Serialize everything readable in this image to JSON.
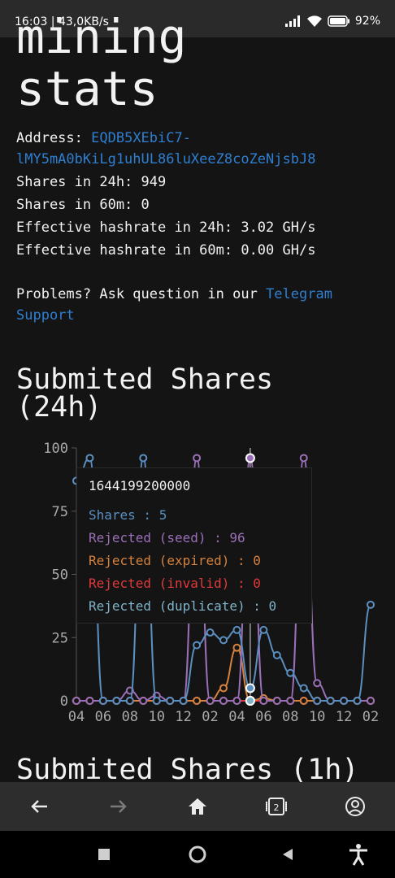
{
  "status": {
    "time": "16:03 | 43,0KB/s",
    "battery": "92"
  },
  "page": {
    "title_line1": "mining",
    "title_line2": "stats",
    "address_label": "Address:",
    "address_part1": "EQDB5XEbiC7-",
    "address_part2": "lMY5mA0bKiLg1uhUL86luXeeZ8coZeNjsbJ8",
    "shares_24h": "Shares in 24h: 949",
    "shares_60m": "Shares in 60m: 0",
    "hashrate_24h": "Effective hashrate in 24h: 3.02 GH/s",
    "hashrate_60m": "Effective hashrate in 60m: 0.00 GH/s",
    "problems_text": "Problems? Ask question in our",
    "telegram_link1": "Telegram",
    "telegram_link2": "Support",
    "section_24h_line1": "Submited Shares",
    "section_24h_line2": "(24h)",
    "section_1h": "Submited Shares (1h)"
  },
  "tooltip": {
    "title": "1644199200000",
    "shares": "Shares : 5",
    "seed": "Rejected (seed) : 96",
    "expired": "Rejected (expired) : 0",
    "invalid": "Rejected (invalid) : 0",
    "duplicate": "Rejected (duplicate) : 0"
  },
  "colors": {
    "shares": "#5b8fc0",
    "seed": "#9b6fb8",
    "expired": "#d6813c",
    "invalid": "#e03a3a",
    "duplicate": "#7fb3c8",
    "link": "#2f7fd1"
  },
  "chart_data": {
    "type": "line",
    "title": "Submited Shares (24h)",
    "categories": [
      "04",
      "05",
      "06",
      "07",
      "08",
      "09",
      "10",
      "11",
      "12",
      "01",
      "02",
      "03",
      "04",
      "05",
      "06",
      "07",
      "08",
      "09",
      "10",
      "11",
      "12",
      "01",
      "02"
    ],
    "x_tick_labels": [
      "04",
      "06",
      "08",
      "10",
      "12",
      "02",
      "04",
      "06",
      "08",
      "10",
      "12",
      "02"
    ],
    "y_ticks": [
      0,
      25,
      50,
      75,
      100
    ],
    "ylim": [
      0,
      100
    ],
    "series": [
      {
        "name": "Shares",
        "color": "#5b8fc0",
        "values": [
          87,
          96,
          0,
          0,
          0,
          96,
          0,
          0,
          0,
          22,
          27,
          24,
          28,
          5,
          28,
          18,
          11,
          5,
          0,
          0,
          0,
          0,
          38
        ]
      },
      {
        "name": "Rejected (seed)",
        "color": "#9b6fb8",
        "values": [
          0,
          0,
          0,
          0,
          4,
          0,
          2,
          0,
          0,
          96,
          0,
          0,
          0,
          96,
          0,
          0,
          0,
          96,
          7,
          0,
          0,
          0,
          0
        ]
      },
      {
        "name": "Rejected (expired)",
        "color": "#d6813c",
        "values": [
          0,
          0,
          0,
          0,
          0,
          0,
          0,
          0,
          0,
          0,
          0,
          5,
          21,
          0,
          1,
          0,
          0,
          0,
          0,
          0,
          0,
          0,
          0
        ]
      },
      {
        "name": "Rejected (invalid)",
        "color": "#e03a3a",
        "values": [
          0,
          0,
          0,
          0,
          0,
          0,
          0,
          0,
          0,
          0,
          0,
          0,
          0,
          0,
          0,
          0,
          0,
          0,
          0,
          0,
          0,
          0,
          0
        ]
      },
      {
        "name": "Rejected (duplicate)",
        "color": "#7fb3c8",
        "values": [
          0,
          0,
          0,
          0,
          0,
          0,
          0,
          0,
          0,
          0,
          0,
          0,
          0,
          0,
          0,
          0,
          0,
          0,
          0,
          0,
          0,
          0,
          0
        ]
      }
    ],
    "grid": false,
    "highlight_index": 13
  }
}
